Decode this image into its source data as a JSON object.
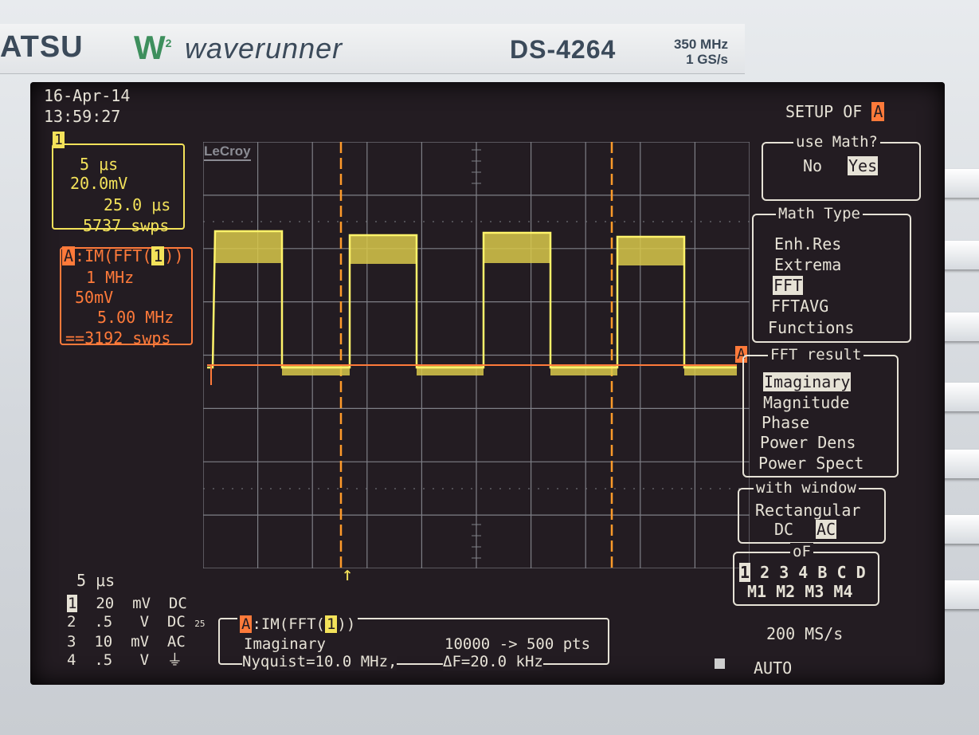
{
  "instrument": {
    "brand_left": "ATSU",
    "brand_w": "W",
    "brand_w_sup": "2",
    "brand_name": "waverunner",
    "model": "DS-4264",
    "bandwidth": "350 MHz",
    "sample_rate_spec": "1 GS/s"
  },
  "status": {
    "date": "16-Apr-14",
    "time": "13:59:27",
    "lecroy_logo": "LeCroy"
  },
  "channel1": {
    "tag": "1",
    "timebase": "5 μs",
    "volts_div": "20.0mV",
    "offset": "25.0 μs",
    "sweeps": "5737 swps"
  },
  "math": {
    "tag": "A",
    "label": ":IM(FFT(",
    "label_ch": "1",
    "label_end": "))",
    "freq_div": "1 MHz",
    "scale": "50mV",
    "center": "5.00 MHz",
    "sweeps": "==3192 swps"
  },
  "setup_menu": {
    "title": "SETUP OF",
    "title_tag": "A",
    "use_math": {
      "title": "use Math?",
      "no": "No",
      "yes": "Yes"
    },
    "math_type": {
      "title": "Math Type",
      "items": [
        "Enh.Res",
        "Extrema",
        "FFT",
        "FFTAVG",
        "Functions"
      ],
      "selected": "FFT"
    },
    "fft_result": {
      "title": "FFT result",
      "items": [
        "Imaginary",
        "Magnitude",
        "Phase",
        "Power Dens",
        "Power Spect"
      ],
      "selected": "Imaginary"
    },
    "with_window": {
      "title": "with window",
      "window": "Rectangular",
      "dc": "DC",
      "ac": "AC"
    },
    "of": {
      "title": "oF",
      "sources": [
        "1",
        "2",
        "3",
        "4",
        "B",
        "C",
        "D"
      ],
      "selected_source": "1",
      "math": [
        "M1",
        "M2",
        "M3",
        "M4"
      ]
    }
  },
  "bottom_left": {
    "timebase": "5 μs",
    "channels": [
      {
        "num": "1",
        "volts": "20",
        "unit": "mV",
        "coupling": "DC",
        "extra": ""
      },
      {
        "num": "2",
        "volts": ".5",
        "unit": "V",
        "coupling": "DC",
        "extra": "25"
      },
      {
        "num": "3",
        "volts": "10",
        "unit": "mV",
        "coupling": "AC",
        "extra": ""
      },
      {
        "num": "4",
        "volts": ".5",
        "unit": "V",
        "coupling": "⏚",
        "extra": ""
      }
    ]
  },
  "info": {
    "tag": "A",
    "title": ":IM(FFT(",
    "title_ch": "1",
    "title_end": "))",
    "line1_left": "Imaginary",
    "line1_right": "10000 -> 500 pts",
    "line2_left": "Nyquist=10.0 MHz,",
    "line2_right": "ΔF=20.0 kHz"
  },
  "acquisition": {
    "sample_rate": "200 MS/s",
    "trigger_mode": "AUTO"
  },
  "colors": {
    "trace_ch1": "#f3e25a",
    "trace_math": "#ff7a3a",
    "text": "#e6e2d6",
    "screen": "#231c22"
  }
}
